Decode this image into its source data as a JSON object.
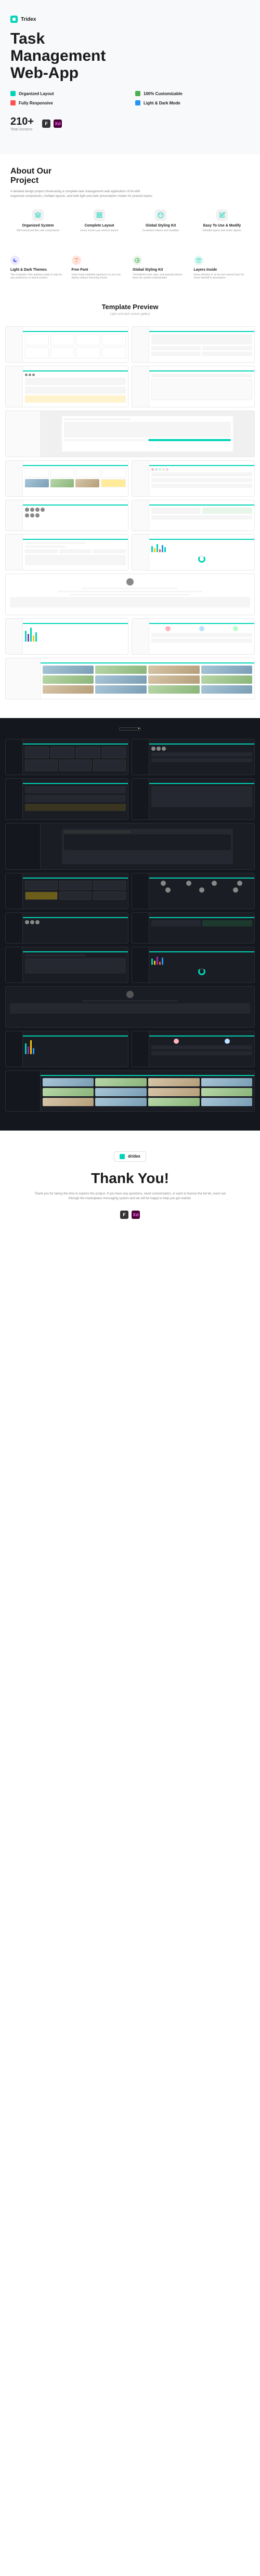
{
  "brand": {
    "name": "Tridex"
  },
  "hero": {
    "title_line1": "Task",
    "title_line2": "Management",
    "title_line3": "Web-App",
    "features": [
      {
        "label": "Organized Layout",
        "color": "teal"
      },
      {
        "label": "100% Customizable",
        "color": "green"
      },
      {
        "label": "Fully Responsive",
        "color": "red"
      },
      {
        "label": "Light & Dark Mode",
        "color": "blue"
      }
    ],
    "count": {
      "number": "210+",
      "label": "Total Screens"
    },
    "tools": [
      {
        "name": "Figma",
        "abbr": "F"
      },
      {
        "name": "Adobe XD",
        "abbr": "Xd"
      }
    ]
  },
  "about": {
    "title": "About Our",
    "title2": "Project",
    "description": "A detailed design project showcasing a complete task management web application UI kit with organized components, multiple layouts, and both light and dark presentation modes for product teams.",
    "top_features": [
      {
        "title": "Organized System",
        "desc": "Well structured files and components"
      },
      {
        "title": "Complete Layout",
        "desc": "Every screen you need to launch"
      },
      {
        "title": "Global Styling Kit",
        "desc": "Consistent tokens and variables"
      },
      {
        "title": "Easy To Use & Modify",
        "desc": "Editable layers and smart objects"
      }
    ],
    "bottom_features": [
      {
        "title": "Light & Dark Themes",
        "desc": "Two complete color palettes ready to ship for any preference or brand context",
        "color": "#667eea"
      },
      {
        "title": "Free Font",
        "desc": "Uses freely available typefaces so you can deploy without licensing friction",
        "color": "#ff7e5f"
      },
      {
        "title": "Global Styling Kit",
        "desc": "Centralized color, type, and spacing tokens keep the system maintainable",
        "color": "#4caf50"
      },
      {
        "title": "Layers Inside",
        "desc": "Every element is on its own named layer for clean handoff to developers",
        "color": "#00d4b8"
      }
    ]
  },
  "preview": {
    "title": "Template Preview",
    "subtitle": "Light and dark screen gallery"
  },
  "thank": {
    "brand": "dridex",
    "title": "Thank You!",
    "description": "Thank you for taking the time to explore this project. If you have any questions, need customization, or want to license the full kit, reach out through the marketplace messaging system and we will be happy to help you get started.",
    "tools": [
      {
        "name": "Figma",
        "abbr": "F"
      },
      {
        "name": "Adobe XD",
        "abbr": "Xd"
      }
    ]
  },
  "accent": "#00d4b8"
}
